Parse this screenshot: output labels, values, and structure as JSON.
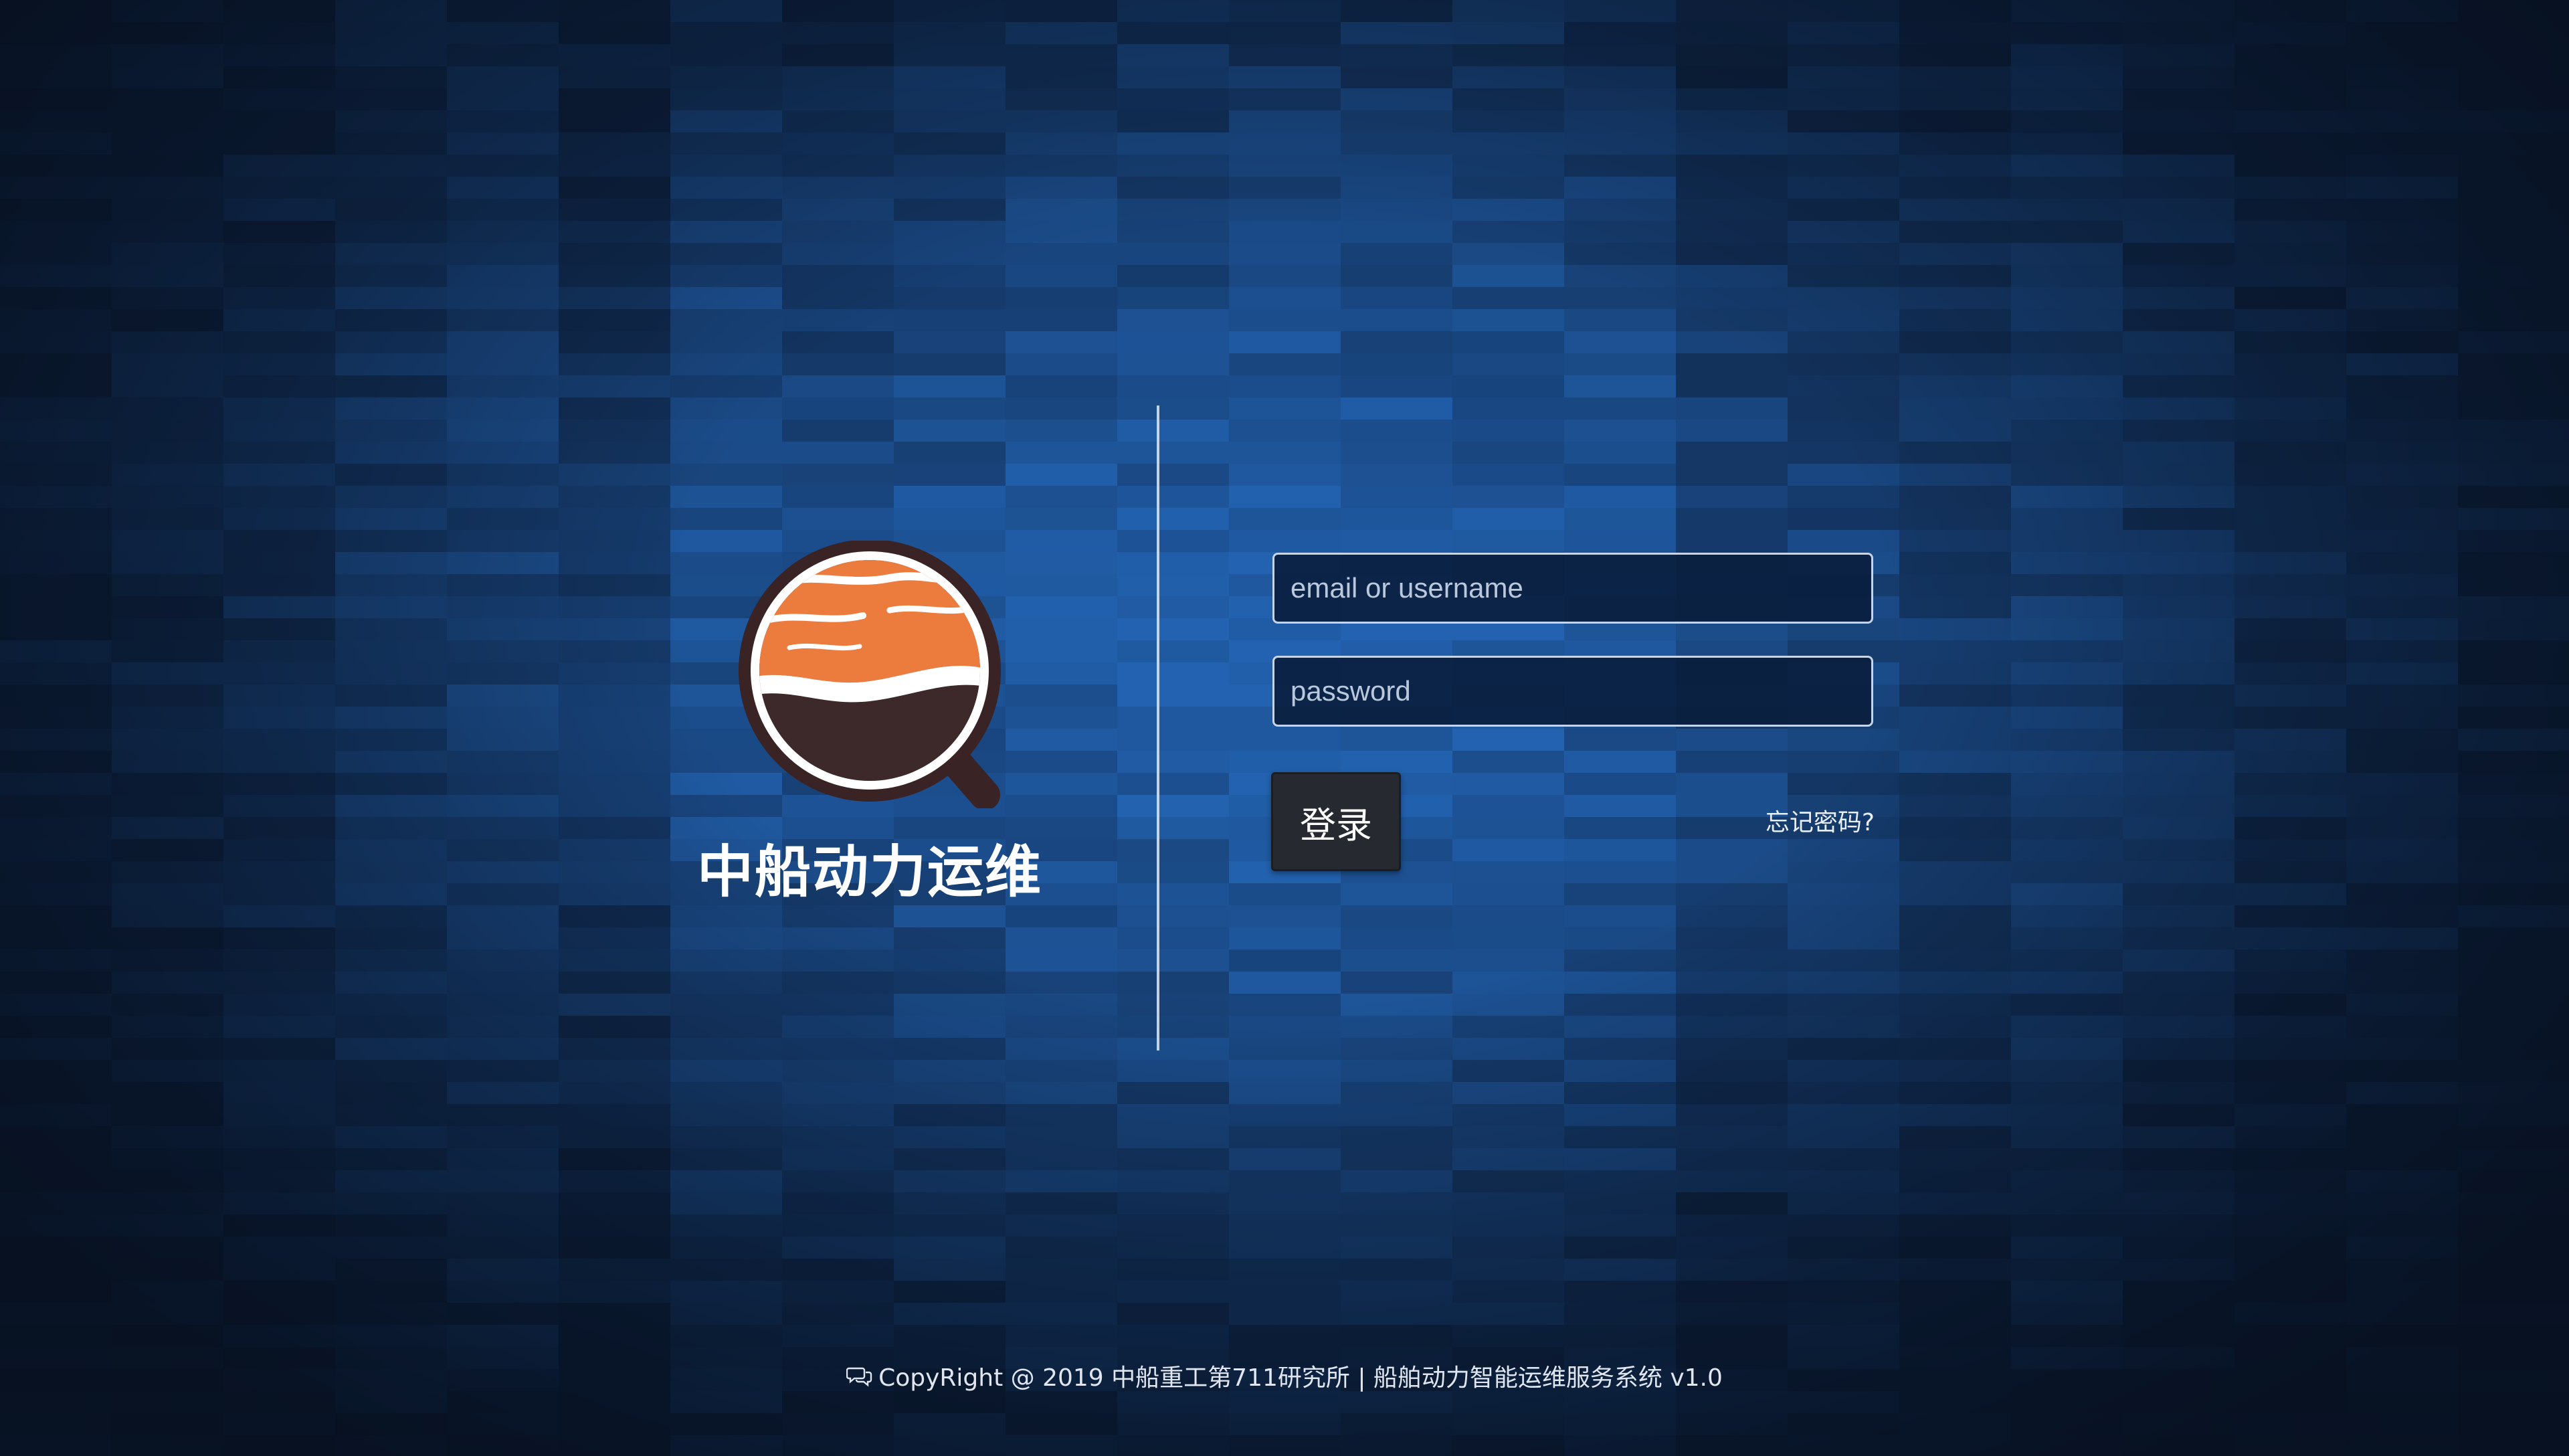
{
  "brand": {
    "title": "中船动力运维",
    "logo": "magnifier-sunset-icon",
    "colors": {
      "ring": "#3a2324",
      "top": "#ec7c3e",
      "bottom": "#3d2929",
      "wave": "#ffffff"
    }
  },
  "login": {
    "username_placeholder": "email or username",
    "username_value": "",
    "password_placeholder": "password",
    "password_value": "",
    "submit_label": "登录",
    "forgot_label": "忘记密码?"
  },
  "footer": {
    "icon": "chat-bubbles-icon",
    "text": "CopyRight @ 2019 中船重工第711研究所 | 船舶动力智能运维服务系统 v1.0"
  },
  "theme": {
    "background_base": "#0f2748",
    "accent_blue": "#1f5fae",
    "button_bg": "#262a30"
  }
}
